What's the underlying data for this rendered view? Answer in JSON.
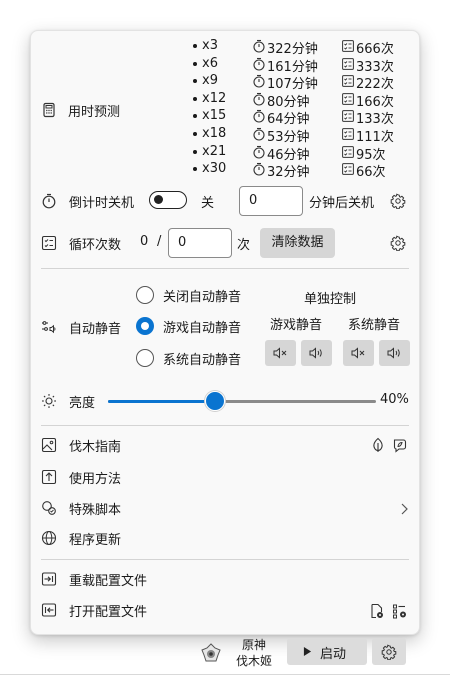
{
  "prediction": {
    "label": "用时预测",
    "rows": [
      {
        "mult": "x3",
        "time": "322分钟",
        "count": "666次"
      },
      {
        "mult": "x6",
        "time": "161分钟",
        "count": "333次"
      },
      {
        "mult": "x9",
        "time": "107分钟",
        "count": "222次"
      },
      {
        "mult": "x12",
        "time": "80分钟",
        "count": "166次"
      },
      {
        "mult": "x15",
        "time": "64分钟",
        "count": "133次"
      },
      {
        "mult": "x18",
        "time": "53分钟",
        "count": "111次"
      },
      {
        "mult": "x21",
        "time": "46分钟",
        "count": "95次"
      },
      {
        "mult": "x30",
        "time": "32分钟",
        "count": "66次"
      }
    ]
  },
  "shutdown": {
    "label": "倒计时关机",
    "toggle_state": "关",
    "value": "0",
    "suffix": "分钟后关机"
  },
  "loop": {
    "label": "循环次数",
    "current": "0",
    "slash": "/",
    "value": "0",
    "unit": "次",
    "clear_label": "清除数据"
  },
  "auto_mute": {
    "label": "自动静音",
    "options": [
      "关闭自动静音",
      "游戏自动静音",
      "系统自动静音"
    ],
    "selected_index": 1,
    "solo_title": "单独控制",
    "game_mute_label": "游戏静音",
    "system_mute_label": "系统静音"
  },
  "brightness": {
    "label": "亮度",
    "value_text": "40%",
    "value": 0.4
  },
  "menu": {
    "guide": "伐木指南",
    "usage": "使用方法",
    "scripts": "特殊脚本",
    "update": "程序更新",
    "reload_config": "重载配置文件",
    "open_config": "打开配置文件"
  },
  "bottom": {
    "game_name": "原神",
    "app_name": "伐木姬",
    "start_label": "启动"
  },
  "colors": {
    "accent": "#0a74d0",
    "menu_bg": "#f9f9f9",
    "button_gray": "#d6d6d6"
  }
}
